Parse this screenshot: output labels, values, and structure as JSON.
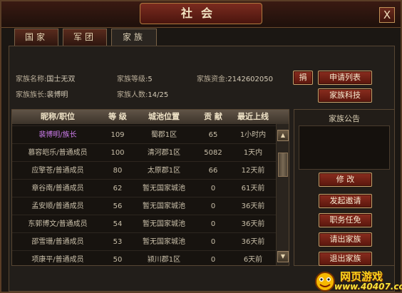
{
  "window": {
    "title": "社会",
    "close_label": "X"
  },
  "tabs": [
    {
      "label": "国家",
      "active": false
    },
    {
      "label": "军团",
      "active": false
    },
    {
      "label": "家族",
      "active": true
    }
  ],
  "family_info": {
    "name_label": "家族名称:",
    "name_value": "国士无双",
    "leader_label": "家族族长:",
    "leader_value": "裴博明",
    "level_label": "家族等级:",
    "level_value": "5",
    "count_label": "家族人数:",
    "count_value": "14/25",
    "funds_label": "家族资金:",
    "funds_value": "2142602050"
  },
  "buttons": {
    "donate": "捐",
    "apply_list": "申请列表",
    "family_tech": "家族科技",
    "modify": "修 改",
    "invite": "发起邀请",
    "appoint": "职务任免",
    "expel": "请出家族",
    "leave": "退出家族"
  },
  "table": {
    "headers": [
      "昵称/职位",
      "等 级",
      "城池位置",
      "贡 献",
      "最近上线"
    ],
    "rows": [
      {
        "name": "裴博明/族长",
        "level": "109",
        "city": "蜀郡1区",
        "contrib": "65",
        "last": "1小时内",
        "highlight": true
      },
      {
        "name": "慕容皑乐/普通成员",
        "level": "100",
        "city": "清河郡1区",
        "contrib": "5082",
        "last": "1天内"
      },
      {
        "name": "应擎苍/普通成员",
        "level": "80",
        "city": "太原郡1区",
        "contrib": "66",
        "last": "12天前"
      },
      {
        "name": "章谷南/普通成员",
        "level": "62",
        "city": "暂无国家城池",
        "contrib": "0",
        "last": "61天前"
      },
      {
        "name": "孟安顺/普通成员",
        "level": "56",
        "city": "暂无国家城池",
        "contrib": "0",
        "last": "36天前"
      },
      {
        "name": "东郭博文/普通成员",
        "level": "54",
        "city": "暂无国家城池",
        "contrib": "0",
        "last": "36天前"
      },
      {
        "name": "邵雪珊/普通成员",
        "level": "53",
        "city": "暂无国家城池",
        "contrib": "0",
        "last": "36天前"
      },
      {
        "name": "项康平/普通成员",
        "level": "50",
        "city": "颍川郡1区",
        "contrib": "0",
        "last": "6天前"
      }
    ]
  },
  "notice": {
    "title": "家族公告"
  },
  "scroll": {
    "up": "▲",
    "down": "▼"
  },
  "watermark": {
    "brand": "网页游戏",
    "url": "www.40407.com"
  }
}
